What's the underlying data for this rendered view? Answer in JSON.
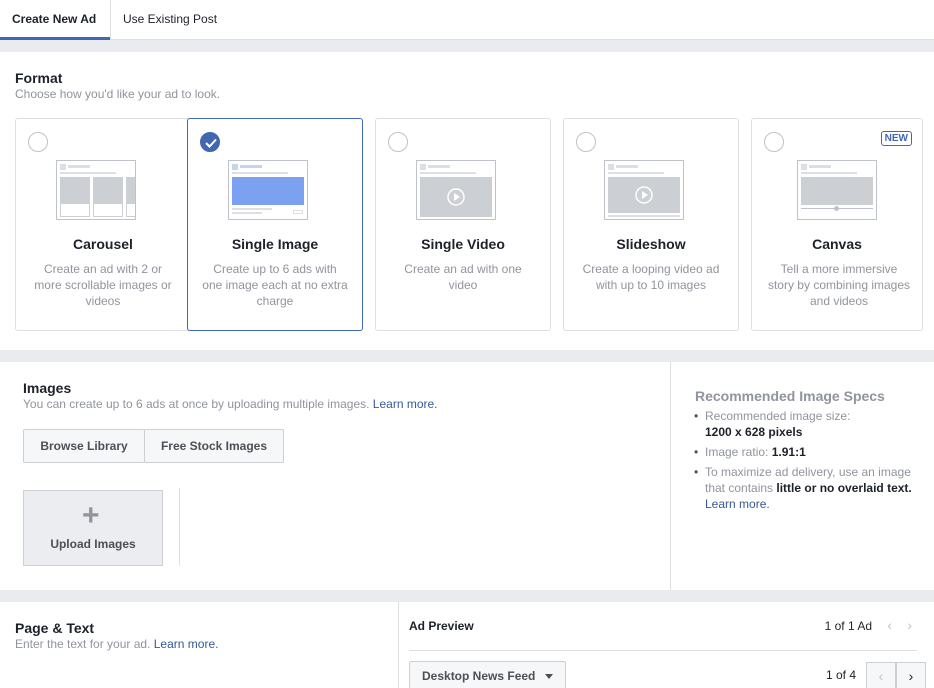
{
  "tabs": {
    "create": "Create New Ad",
    "existing": "Use Existing Post"
  },
  "format": {
    "title": "Format",
    "subtitle": "Choose how you'd like your ad to look.",
    "cards": [
      {
        "title": "Carousel",
        "desc": "Create an ad with 2 or more scrollable images or videos"
      },
      {
        "title": "Single Image",
        "desc": "Create up to 6 ads with one image each at no extra charge"
      },
      {
        "title": "Single Video",
        "desc": "Create an ad with one video"
      },
      {
        "title": "Slideshow",
        "desc": "Create a looping video ad with up to 10 images"
      },
      {
        "title": "Canvas",
        "desc": "Tell a more immersive story by combining images and videos",
        "badge": "NEW"
      }
    ]
  },
  "images": {
    "title": "Images",
    "subtitle": "You can create up to 6 ads at once by uploading multiple images.",
    "learn_more": "Learn more.",
    "browse_label": "Browse Library",
    "stock_label": "Free Stock Images",
    "upload_label": "Upload Images"
  },
  "specs": {
    "title": "Recommended Image Specs",
    "size_label": "Recommended image size:",
    "size_value": "1200 x 628 pixels",
    "ratio_label": "Image ratio:",
    "ratio_value": "1.91:1",
    "delivery_text": "To maximize ad delivery, use an image that contains",
    "delivery_bold": "little or no overlaid text.",
    "learn_more": "Learn more."
  },
  "page_text": {
    "title": "Page & Text",
    "subtitle": "Enter the text for your ad.",
    "learn_more": "Learn more."
  },
  "preview": {
    "title": "Ad Preview",
    "count": "1 of 1 Ad",
    "placement": "Desktop News Feed",
    "pages": "1 of 4"
  },
  "colors": {
    "accent": "#4267b2",
    "link": "#365899",
    "muted": "#90949c"
  }
}
